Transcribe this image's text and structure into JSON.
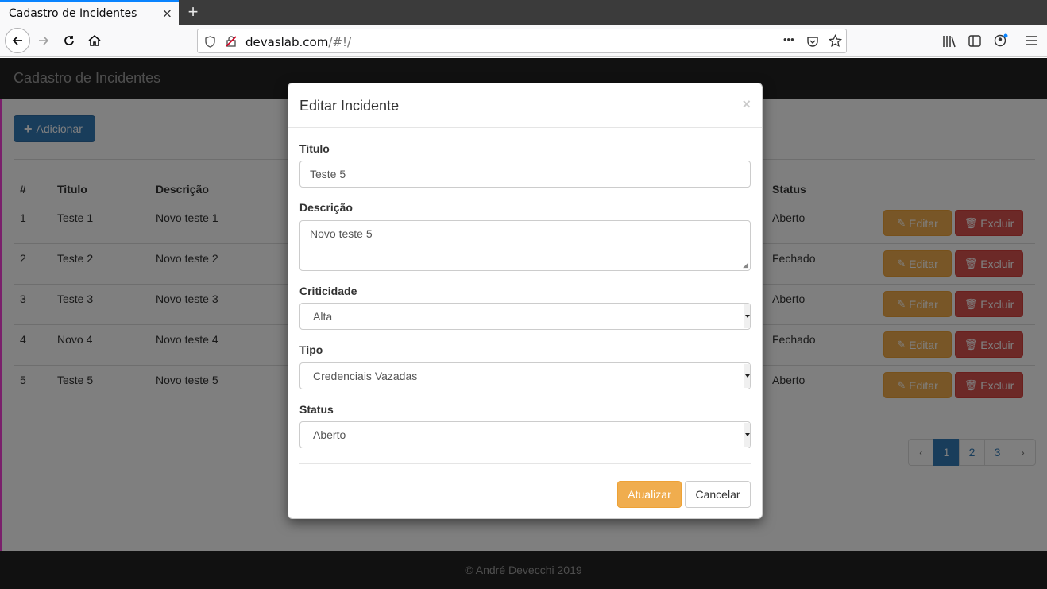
{
  "browser": {
    "tab_title": "Cadastro de Incidentes",
    "tab_close": "×",
    "new_tab": "+",
    "url_host": "devaslab.com",
    "url_path": "/#!/",
    "page_actions": "•••"
  },
  "app": {
    "brand": "Cadastro de Incidentes",
    "add_button": "Adicionar",
    "add_icon": "+",
    "columns": {
      "num": "#",
      "titulo": "Titulo",
      "descricao": "Descrição",
      "status": "Status"
    },
    "rows": [
      {
        "num": "1",
        "titulo": "Teste 1",
        "descricao": "Novo teste 1",
        "status": "Aberto"
      },
      {
        "num": "2",
        "titulo": "Teste 2",
        "descricao": "Novo teste 2",
        "status": "Fechado"
      },
      {
        "num": "3",
        "titulo": "Teste 3",
        "descricao": "Novo teste 3",
        "status": "Aberto"
      },
      {
        "num": "4",
        "titulo": "Novo 4",
        "descricao": "Novo teste 4",
        "status": "Fechado"
      },
      {
        "num": "5",
        "titulo": "Teste 5",
        "descricao": "Novo teste 5",
        "status": "Aberto"
      }
    ],
    "edit_label": "Editar",
    "delete_label": "Excluir",
    "pagination": {
      "prev": "‹",
      "pages": [
        "1",
        "2",
        "3"
      ],
      "next": "›",
      "active_page": "1"
    },
    "footer": "© André Devecchi 2019"
  },
  "modal": {
    "title": "Editar Incidente",
    "close": "×",
    "titulo_label": "Titulo",
    "titulo_value": "Teste 5",
    "descricao_label": "Descrição",
    "descricao_value": "Novo teste 5",
    "criticidade_label": "Criticidade",
    "criticidade_value": "Alta",
    "tipo_label": "Tipo",
    "tipo_value": "Credenciais Vazadas",
    "status_label": "Status",
    "status_value": "Aberto",
    "update_button": "Atualizar",
    "cancel_button": "Cancelar"
  },
  "colors": {
    "primary": "#337ab7",
    "warning": "#f0ad4e",
    "danger": "#d9534f",
    "navbar": "#222222"
  }
}
